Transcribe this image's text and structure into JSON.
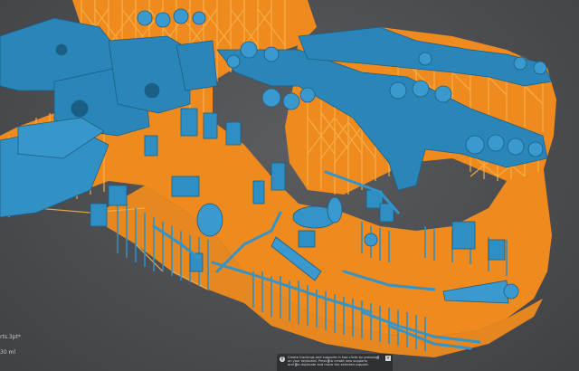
{
  "canvas": {
    "background": "#4b4d50",
    "plate_color": "#ef8a1e",
    "support_color": "#f4a23a",
    "model_color": "#2a86b8",
    "model_highlight": "#4aa6d6"
  },
  "sidebar_labels": {
    "file_name": "rts.3pt*",
    "status": "30 ml"
  },
  "hint": {
    "line1_pre": "Create trackings and supports in two clicks by pressing",
    "key1": "",
    "line2_pre": "on your keyboard. Press",
    "key2": "",
    "line2_post": "to create new supports",
    "line3_pre": "and",
    "key3": "",
    "line3_post": "to duplicate and move the selected support."
  },
  "icons": {
    "info": "info-icon",
    "close": "close-icon"
  }
}
